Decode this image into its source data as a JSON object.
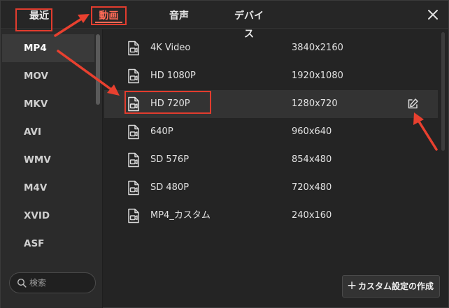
{
  "tabs": {
    "recent": "最近",
    "video": "動画",
    "audio": "音声",
    "device": "デバイス"
  },
  "formats": [
    "MP4",
    "MOV",
    "MKV",
    "AVI",
    "WMV",
    "M4V",
    "XVID",
    "ASF"
  ],
  "selected_format": "MP4",
  "search": {
    "placeholder": "検索",
    "value": ""
  },
  "presets": [
    {
      "name": "4K Video",
      "resolution": "3840x2160"
    },
    {
      "name": "HD 1080P",
      "resolution": "1920x1080"
    },
    {
      "name": "HD 720P",
      "resolution": "1280x720"
    },
    {
      "name": "640P",
      "resolution": "960x640"
    },
    {
      "name": "SD 576P",
      "resolution": "854x480"
    },
    {
      "name": "SD 480P",
      "resolution": "720x480"
    },
    {
      "name": "MP4_カスタム",
      "resolution": "240x160"
    }
  ],
  "selected_preset": "HD 720P",
  "create_button": {
    "plus": "+",
    "label": "カスタム設定の作成"
  },
  "icons": {
    "close": "close-icon",
    "search": "search-icon",
    "preset": "video-file-icon",
    "edit": "edit-icon"
  },
  "colors": {
    "accent": "#ff6b57",
    "annotation": "#e23c2e",
    "background": "#242424",
    "sidebar": "#2b2b2b"
  }
}
